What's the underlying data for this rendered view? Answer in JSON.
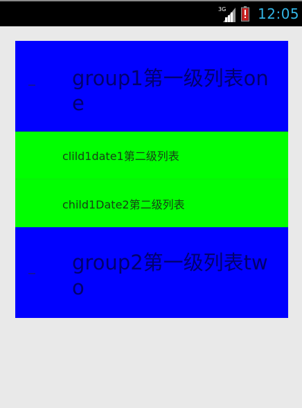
{
  "status_bar": {
    "network_type": "3G",
    "time": "12:05",
    "icons": [
      "signal-icon",
      "battery-alert-icon"
    ],
    "colors": {
      "background": "#000000",
      "clock": "#33b5e5",
      "battery_alert": "#e02020"
    }
  },
  "list": {
    "groups": [
      {
        "title": "group1第一级列表one",
        "expanded": true,
        "children": [
          {
            "label": "clild1date1第二级列表"
          },
          {
            "label": "child1Date2第二级列表"
          }
        ]
      },
      {
        "title": "group2第一级列表two",
        "expanded": false,
        "children": []
      }
    ],
    "colors": {
      "group_background": "#0000ff",
      "child_background": "#00ff00",
      "page_background": "#e9e9e9"
    }
  }
}
